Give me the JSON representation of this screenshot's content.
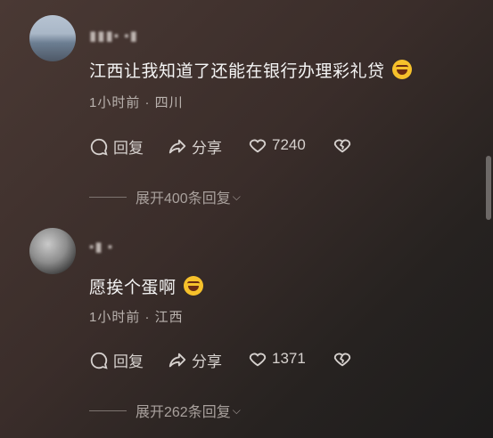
{
  "comments": [
    {
      "username": "▮▮▮▪ ▪▮",
      "text": "江西让我知道了还能在银行办理彩礼贷",
      "emoji": "rofl-emoji",
      "meta": "1小时前 · 四川",
      "reply_label": "回复",
      "share_label": "分享",
      "likes": "7240",
      "expand_label": "展开400条回复"
    },
    {
      "username": "▪▮ ▪",
      "text": "愿挨个蛋啊",
      "emoji": "rofl-emoji",
      "meta": "1小时前 · 江西",
      "reply_label": "回复",
      "share_label": "分享",
      "likes": "1371",
      "expand_label": "展开262条回复"
    }
  ],
  "colors": {
    "background_start": "#4a3934",
    "background_end": "#1d1c1c",
    "text": "#f4f4f4",
    "secondary": "#b9b2ae"
  }
}
